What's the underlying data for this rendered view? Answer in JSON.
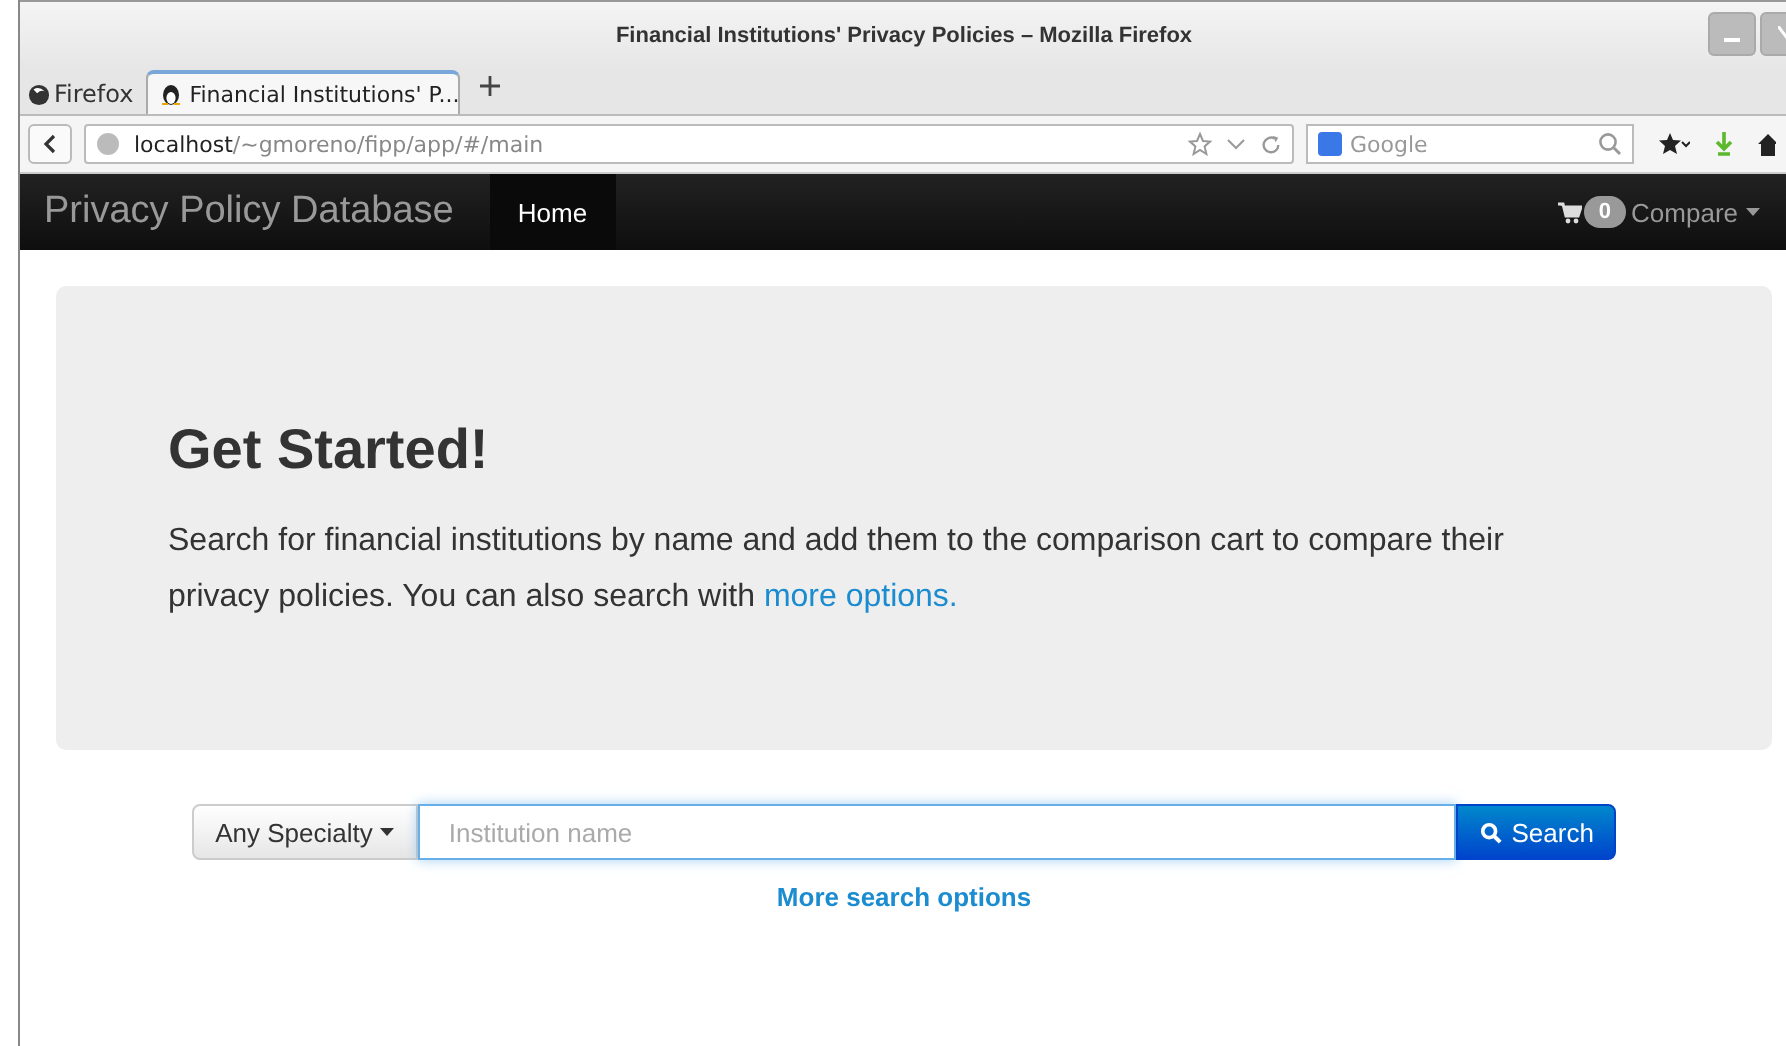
{
  "window": {
    "title": "Financial Institutions' Privacy Policies – Mozilla Firefox"
  },
  "menu_button": "Firefox",
  "tabs": [
    {
      "label": "Financial Institutions' P...",
      "selected": true
    }
  ],
  "toolbar": {
    "url_host": "localhost",
    "url_path": "/~gmoreno/fipp/app/#/main",
    "search_placeholder": "Google"
  },
  "navbar": {
    "brand": "Privacy Policy Database",
    "items": [
      {
        "label": "Home",
        "selected": true
      }
    ],
    "cart_count": "0",
    "compare": "Compare"
  },
  "jumbotron": {
    "heading": "Get Started!",
    "text": "Search for financial institutions by name and add them to the comparison cart to compare their privacy policies. You can also search with ",
    "link": "more options."
  },
  "search": {
    "specialty": "Any Specialty",
    "placeholder": "Institution name",
    "button": "Search",
    "more": "More search options"
  }
}
